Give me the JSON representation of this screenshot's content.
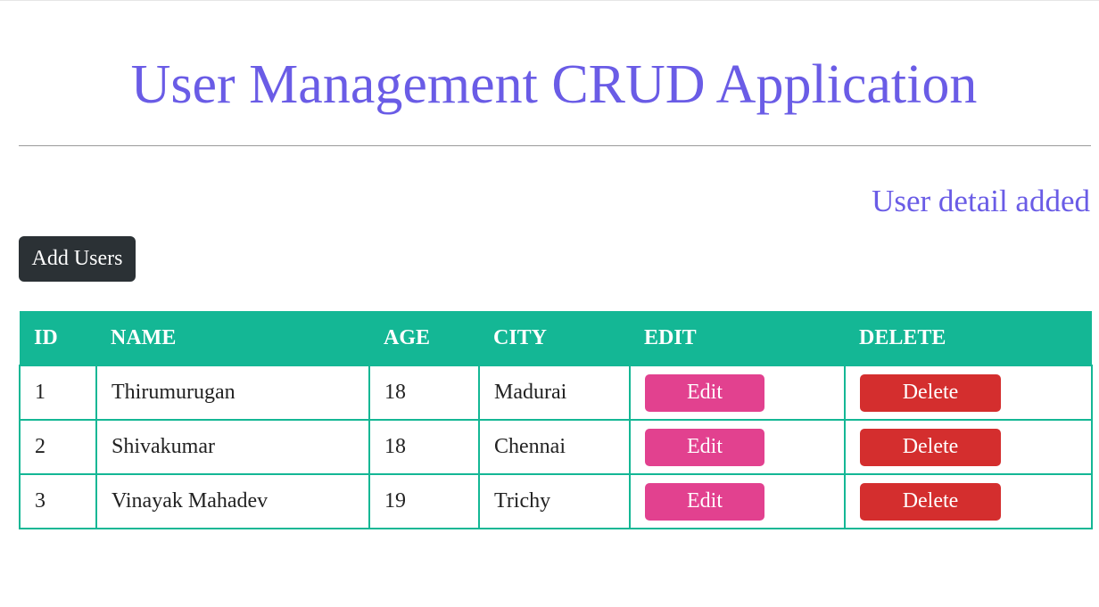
{
  "header": {
    "title": "User Management CRUD Application"
  },
  "status_message": "User detail added",
  "toolbar": {
    "add_label": "Add Users"
  },
  "table": {
    "columns": [
      "ID",
      "NAME",
      "AGE",
      "CITY",
      "EDIT",
      "DELETE"
    ],
    "rows": [
      {
        "id": "1",
        "name": "Thirumurugan",
        "age": "18",
        "city": "Madurai",
        "edit_label": "Edit",
        "delete_label": "Delete"
      },
      {
        "id": "2",
        "name": "Shivakumar",
        "age": "18",
        "city": "Chennai",
        "edit_label": "Edit",
        "delete_label": "Delete"
      },
      {
        "id": "3",
        "name": "Vinayak Mahadev",
        "age": "19",
        "city": "Trichy",
        "edit_label": "Edit",
        "delete_label": "Delete"
      }
    ]
  },
  "colors": {
    "title": "#6a5ce6",
    "table_header": "#14b795",
    "add_button": "#2b3135",
    "edit_button": "#e2418f",
    "delete_button": "#d42e2e"
  }
}
